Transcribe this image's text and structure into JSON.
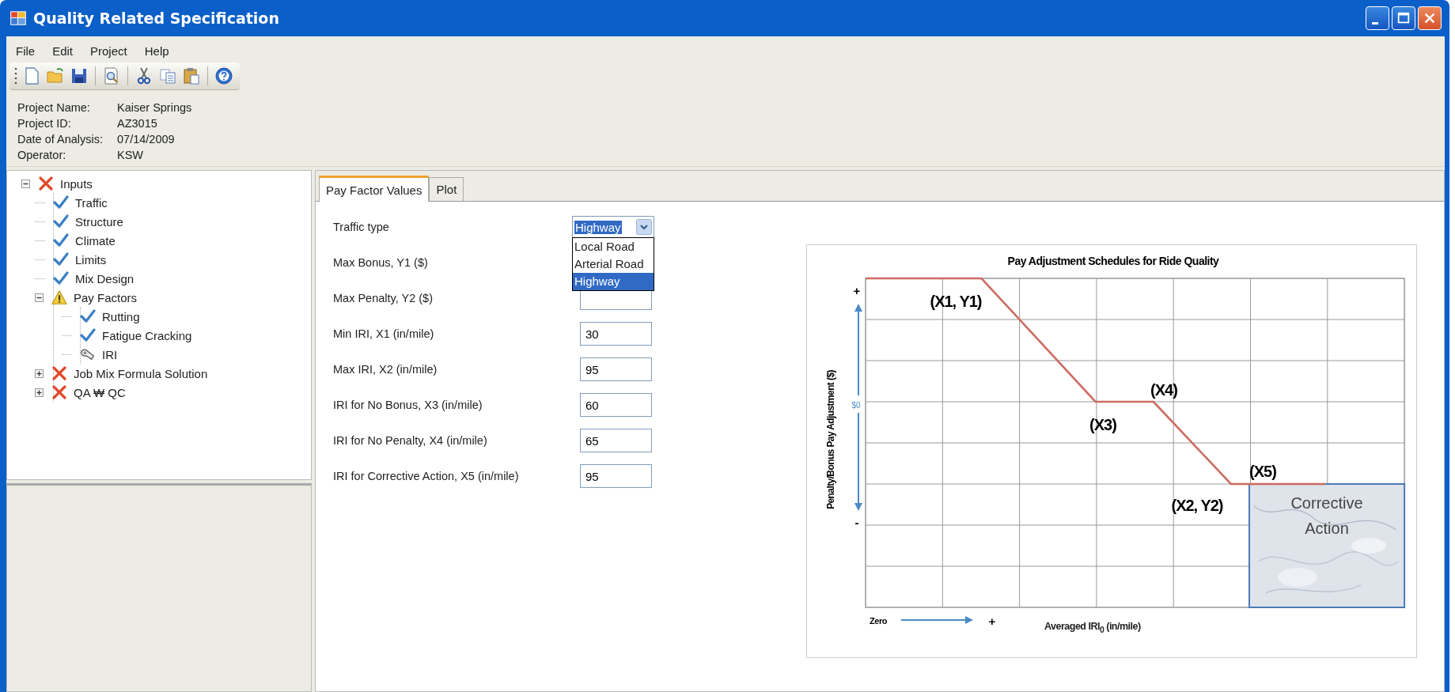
{
  "window": {
    "title": "Quality Related Specification"
  },
  "menu": [
    "File",
    "Edit",
    "Project",
    "Help"
  ],
  "project_info": [
    {
      "label": "Project Name:",
      "value": "Kaiser Springs"
    },
    {
      "label": "Project ID:",
      "value": "AZ3015"
    },
    {
      "label": "Date of Analysis:",
      "value": "07/14/2009"
    },
    {
      "label": "Operator:",
      "value": "KSW"
    }
  ],
  "tree": [
    {
      "label": "Inputs",
      "kind": "error",
      "expanded": true,
      "children": [
        {
          "label": "Traffic",
          "kind": "ok"
        },
        {
          "label": "Structure",
          "kind": "ok"
        },
        {
          "label": "Climate",
          "kind": "ok"
        },
        {
          "label": "Limits",
          "kind": "ok"
        },
        {
          "label": "Mix Design",
          "kind": "ok"
        },
        {
          "label": "Pay Factors",
          "kind": "warning",
          "expanded": true,
          "children": [
            {
              "label": "Rutting",
              "kind": "ok"
            },
            {
              "label": "Fatigue Cracking",
              "kind": "ok"
            },
            {
              "label": "IRI",
              "kind": "pending"
            }
          ]
        },
        {
          "label": "Job Mix Formula Solution",
          "kind": "error",
          "expanded": false
        },
        {
          "label": "QA ₩ QC",
          "kind": "error",
          "expanded": false
        }
      ]
    }
  ],
  "tabs": [
    {
      "label": "Pay Factor Values",
      "selected": true
    },
    {
      "label": "Plot",
      "selected": false
    }
  ],
  "form": {
    "traffic_type": {
      "label": "Traffic type",
      "value": "Highway",
      "open": true,
      "options": [
        {
          "label": "Local Road",
          "selected": false
        },
        {
          "label": "Arterial Road",
          "selected": false
        },
        {
          "label": "Highway",
          "selected": true
        }
      ]
    },
    "fields": [
      {
        "label": "Max Bonus, Y1 ($)"
      },
      {
        "label": "Max Penalty, Y2 ($)"
      },
      {
        "label": "Min IRI, X1 (in/mile)",
        "value": "30"
      },
      {
        "label": "Max IRI, X2 (in/mile)",
        "value": "95"
      },
      {
        "label": "IRI for No Bonus, X3 (in/mile)",
        "value": "60"
      },
      {
        "label": "IRI for No Penalty, X4 (in/mile)",
        "value": "65"
      },
      {
        "label": "IRI for Corrective Action, X5 (in/mile)",
        "value": "95"
      }
    ]
  },
  "diagram": {
    "title": "Pay Adjustment Schedules for Ride Quality",
    "y_axis_label": "Penalty/Bonus Pay Adjustment ($)",
    "y_plus": "+",
    "y_zero": "$0",
    "y_minus": "-",
    "x_start": "Zero",
    "x_plus": "+",
    "x_axis_label": "Averaged IRI$_{0}$ (in/mile)",
    "point_labels": [
      "(X1, Y1)",
      "(X3)",
      "(X4)",
      "(X5)",
      "(X2, Y2)"
    ],
    "region_label": [
      "Corrective",
      "Action"
    ]
  }
}
